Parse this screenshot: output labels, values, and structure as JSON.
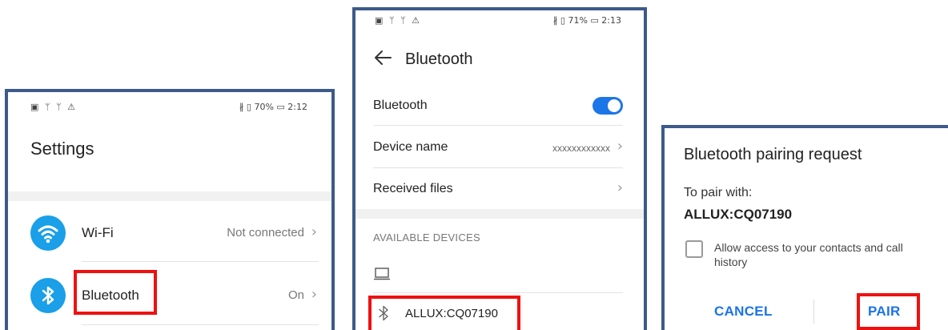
{
  "screens": {
    "settings": {
      "status": {
        "left_icons": "▣ ᛘ ᛘ ⚠",
        "right": "∦ ▯ 70% ▭ 2:12"
      },
      "title": "Settings",
      "wifi": {
        "label": "Wi-Fi",
        "value": "Not connected"
      },
      "bluetooth": {
        "label": "Bluetooth",
        "value": "On"
      }
    },
    "bluetooth": {
      "status": {
        "left_icons": "▣ ᛘ ᛘ ⚠",
        "right": "∦ ▯ 71% ▭ 2:13"
      },
      "title": "Bluetooth",
      "toggle_label": "Bluetooth",
      "toggle_on": true,
      "device_name_label": "Device name",
      "device_name_value": "xxxxxxxxxxxx",
      "received_files_label": "Received files",
      "available_header": "AVAILABLE DEVICES",
      "device": "ALLUX:CQ07190"
    },
    "pairing": {
      "title": "Bluetooth pairing request",
      "to_pair_with": "To pair with:",
      "device": "ALLUX:CQ07190",
      "checkbox_label": "Allow access to your contacts and call history",
      "cancel": "CANCEL",
      "pair": "PAIR"
    }
  },
  "colors": {
    "frame": "#3c5a8a",
    "highlight": "#ee1111",
    "accent": "#1a73e8",
    "icon_bg": "#1a9fe8"
  },
  "icons": {
    "wifi": "wifi-icon",
    "bluetooth": "bluetooth-icon",
    "back": "back-arrow-icon",
    "chevron": "chevron-right-icon",
    "laptop": "laptop-icon"
  }
}
